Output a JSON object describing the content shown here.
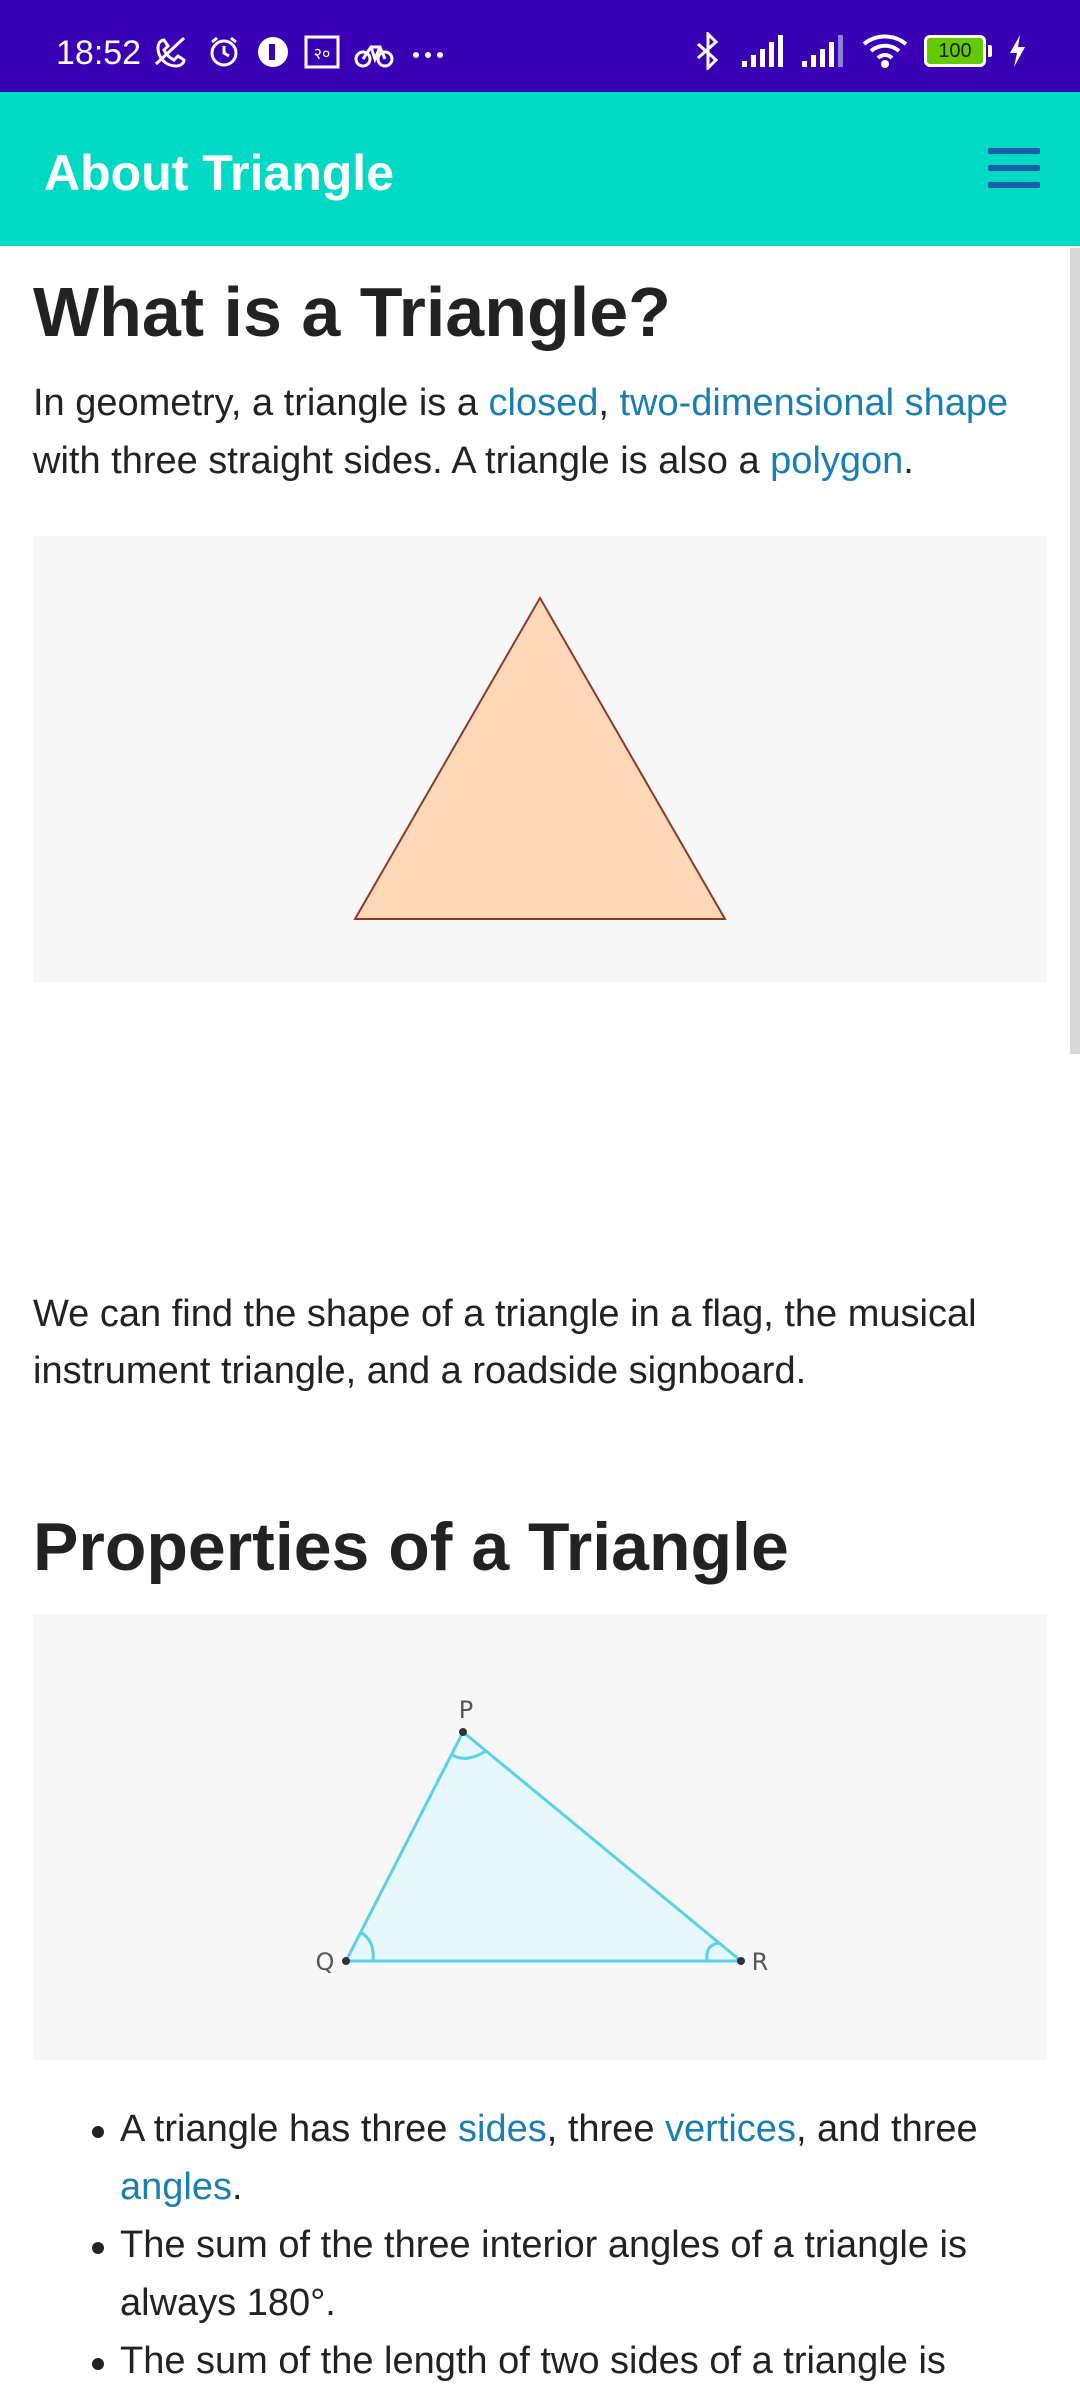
{
  "status_bar": {
    "time": "18:52",
    "left_icons": [
      "mute-call-icon",
      "alarm-icon",
      "app-icon",
      "rupee-sim-icon",
      "bike-icon",
      "more-icon"
    ],
    "battery": "100",
    "right_icons": [
      "bluetooth-icon",
      "signal-icon",
      "signal-icon-2",
      "wifi-icon",
      "battery-icon",
      "charging-icon"
    ]
  },
  "app_bar": {
    "title": "About Triangle",
    "menu_icon": "menu-icon"
  },
  "section1": {
    "heading": "What is a Triangle?",
    "intro": {
      "t1": "In geometry, a triangle is a ",
      "link_closed": "closed",
      "t2": ", ",
      "link_two_dim": "two-dimensional shape",
      "t3": " with three straight sides. A triangle is also a ",
      "link_polygon": "polygon",
      "t4": "."
    },
    "paragraph2": "We can find the shape of a triangle in a flag, the musical instrument triangle, and a roadside signboard."
  },
  "section2": {
    "heading": "Properties of a Triangle",
    "diagram_labels": {
      "P": "P",
      "Q": "Q",
      "R": "R"
    },
    "bullets": [
      {
        "t1": "A triangle has three ",
        "link_sides": "sides",
        "t2": ", three ",
        "link_vertices": "vertices",
        "t3": ", and three ",
        "link_angles": "angles",
        "t4": "."
      },
      {
        "text": "The sum of the three interior angles of a triangle is always 180°."
      },
      {
        "text": "The sum of the length of two sides of a triangle is"
      }
    ]
  },
  "colors": {
    "status_bar": "#3a00b4",
    "app_bar": "#00dac4",
    "link": "#1a7fb0",
    "triangle1_fill": "#ffd8b8",
    "triangle1_stroke": "#8a3a2a",
    "triangle2_fill": "#e6f8fc",
    "triangle2_stroke": "#5ad0ea"
  }
}
